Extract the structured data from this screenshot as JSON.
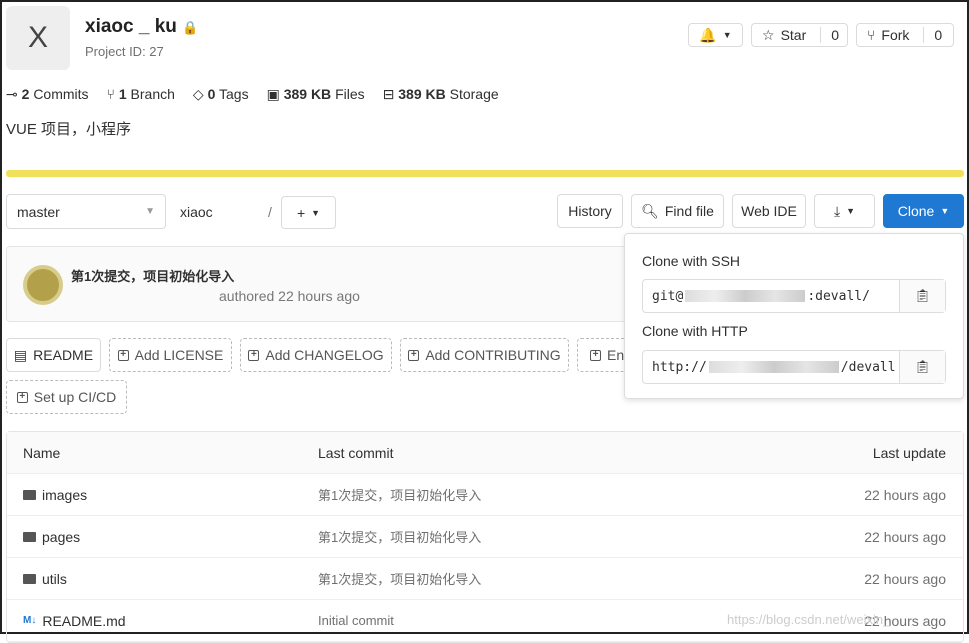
{
  "project": {
    "initial": "X",
    "name": "xiaoc _ ku",
    "id_label": "Project ID: 27",
    "description": "VUE 项目，小程序"
  },
  "header": {
    "star": "Star",
    "star_count": "0",
    "fork": "Fork",
    "fork_count": "0"
  },
  "stats": [
    {
      "v": "2",
      "l": "Commits"
    },
    {
      "v": "1",
      "l": "Branch"
    },
    {
      "v": "0",
      "l": "Tags"
    },
    {
      "v": "389 KB",
      "l": "Files"
    },
    {
      "v": "389 KB",
      "l": "Storage"
    }
  ],
  "language_bar_color": "#f1e05a",
  "toolbar": {
    "branch": "master",
    "path": "xiaoc",
    "sep": "/",
    "history": "History",
    "find_file": "Find file",
    "web_ide": "Web IDE",
    "clone": "Clone"
  },
  "commit": {
    "title": "第1次提交，项目初始化导入",
    "meta": "authored 22 hours ago"
  },
  "shortcuts": [
    "README",
    "Add LICENSE",
    "Add CHANGELOG",
    "Add CONTRIBUTING",
    "En",
    "Set up CI/CD"
  ],
  "clone": {
    "ssh_label": "Clone with SSH",
    "ssh_prefix": "git@",
    "ssh_suffix": ":devall/",
    "http_label": "Clone with HTTP",
    "http_prefix": "http://",
    "http_suffix": "/devall"
  },
  "table": {
    "headers": [
      "Name",
      "Last commit",
      "Last update"
    ],
    "rows": [
      {
        "name": "images",
        "commit": "第1次提交，项目初始化导入",
        "time": "22 hours ago"
      },
      {
        "name": "pages",
        "commit": "第1次提交，项目初始化导入",
        "time": "22 hours ago"
      },
      {
        "name": "utils",
        "commit": "第1次提交，项目初始化导入",
        "time": "22 hours ago"
      },
      {
        "name": "README.md",
        "commit": "Initial commit",
        "time": "22 hours ago"
      }
    ]
  },
  "watermark": "https://blog.csdn.net/weixin_"
}
